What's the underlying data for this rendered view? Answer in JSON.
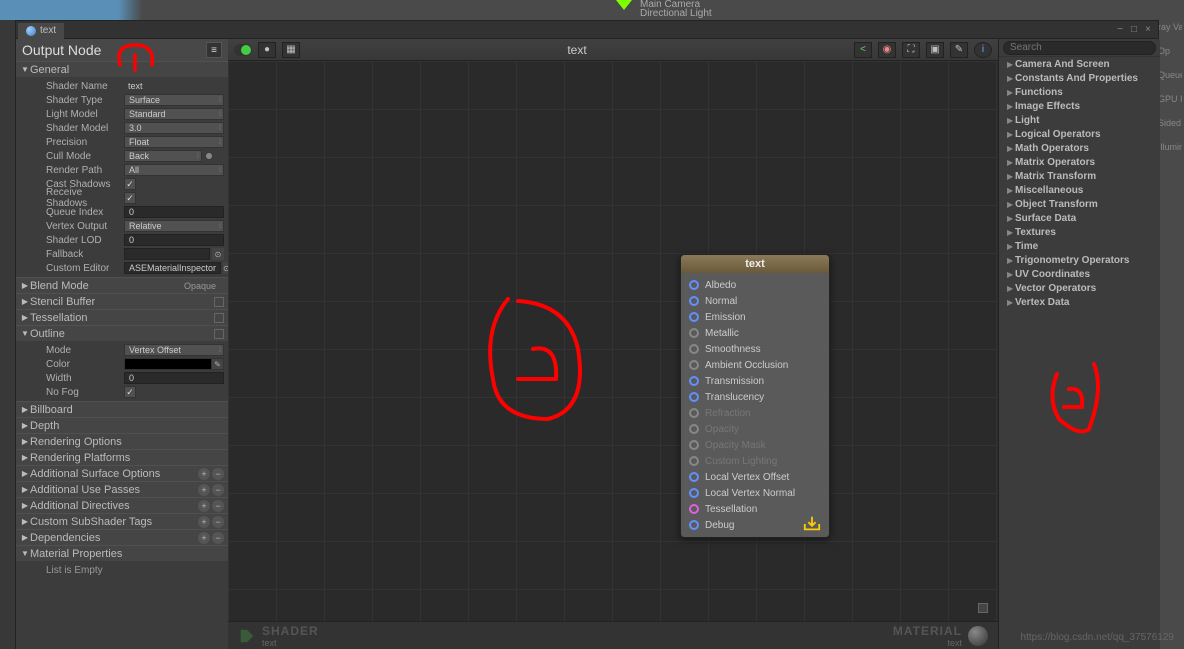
{
  "top_hierarchy": {
    "cam": "Main Camera",
    "light": "Directional Light"
  },
  "right_bg": {
    "op": "Op",
    "queue": "Queue",
    "gpu": "GPU In",
    "sided": "Sided",
    "illumin": "Illumin",
    "ray": "ray Val"
  },
  "tab": {
    "label": "text"
  },
  "window_controls": {
    "min": "−",
    "max": "□",
    "close": "×"
  },
  "left_panel": {
    "title": "Output Node",
    "wiki": "≡",
    "general": {
      "title": "General",
      "shader_name_label": "Shader Name",
      "shader_name": "text",
      "shader_type_label": "Shader Type",
      "shader_type": "Surface",
      "light_model_label": "Light Model",
      "light_model": "Standard",
      "shader_model_label": "Shader Model",
      "shader_model": "3.0",
      "precision_label": "Precision",
      "precision": "Float",
      "cull_mode_label": "Cull Mode",
      "cull_mode": "Back",
      "render_path_label": "Render Path",
      "render_path": "All",
      "cast_shadows_label": "Cast Shadows",
      "receive_shadows_label": "Receive Shadows",
      "queue_index_label": "Queue Index",
      "queue_index": "0",
      "vertex_output_label": "Vertex Output",
      "vertex_output": "Relative",
      "shader_lod_label": "Shader LOD",
      "shader_lod": "0",
      "fallback_label": "Fallback",
      "fallback": "",
      "custom_editor_label": "Custom Editor",
      "custom_editor": "ASEMaterialInspector"
    },
    "sections": {
      "blend_mode": "Blend Mode",
      "blend_mode_val": "Opaque",
      "stencil_buffer": "Stencil Buffer",
      "tessellation": "Tessellation",
      "outline": "Outline",
      "billboard": "Billboard",
      "depth": "Depth",
      "rendering_options": "Rendering Options",
      "rendering_platforms": "Rendering Platforms",
      "additional_surface": "Additional Surface Options",
      "additional_use_passes": "Additional Use Passes",
      "additional_directives": "Additional Directives",
      "custom_subshader": "Custom SubShader Tags",
      "dependencies": "Dependencies",
      "material_props": "Material Properties",
      "list_empty": "List is Empty"
    },
    "outline": {
      "mode_label": "Mode",
      "mode": "Vertex Offset",
      "color_label": "Color",
      "width_label": "Width",
      "width": "0",
      "nofog_label": "No Fog"
    }
  },
  "canvas": {
    "title": "text",
    "shader_label": "SHADER",
    "shader_sub": "text",
    "material_label": "MATERIAL",
    "material_sub": "text"
  },
  "node": {
    "title": "text",
    "ports": [
      {
        "label": "Albedo",
        "color": "blue",
        "enabled": true
      },
      {
        "label": "Normal",
        "color": "blue",
        "enabled": true
      },
      {
        "label": "Emission",
        "color": "blue",
        "enabled": true
      },
      {
        "label": "Metallic",
        "color": "grey",
        "enabled": true
      },
      {
        "label": "Smoothness",
        "color": "grey",
        "enabled": true
      },
      {
        "label": "Ambient Occlusion",
        "color": "grey",
        "enabled": true
      },
      {
        "label": "Transmission",
        "color": "blue",
        "enabled": true
      },
      {
        "label": "Translucency",
        "color": "blue",
        "enabled": true
      },
      {
        "label": "Refraction",
        "color": "grey",
        "enabled": false
      },
      {
        "label": "Opacity",
        "color": "grey",
        "enabled": false
      },
      {
        "label": "Opacity Mask",
        "color": "grey",
        "enabled": false
      },
      {
        "label": "Custom Lighting",
        "color": "grey",
        "enabled": false
      },
      {
        "label": "Local Vertex Offset",
        "color": "blue",
        "enabled": true
      },
      {
        "label": "Local Vertex Normal",
        "color": "blue",
        "enabled": true
      },
      {
        "label": "Tessellation",
        "color": "magenta",
        "enabled": true
      },
      {
        "label": "Debug",
        "color": "blue",
        "enabled": true
      }
    ]
  },
  "palette": {
    "search_placeholder": "Search",
    "categories": [
      "Camera And Screen",
      "Constants And Properties",
      "Functions",
      "Image Effects",
      "Light",
      "Logical Operators",
      "Math Operators",
      "Matrix Operators",
      "Matrix Transform",
      "Miscellaneous",
      "Object Transform",
      "Surface Data",
      "Textures",
      "Time",
      "Trigonometry Operators",
      "UV Coordinates",
      "Vector Operators",
      "Vertex Data"
    ]
  },
  "watermark": "https://blog.csdn.net/qq_37576129"
}
